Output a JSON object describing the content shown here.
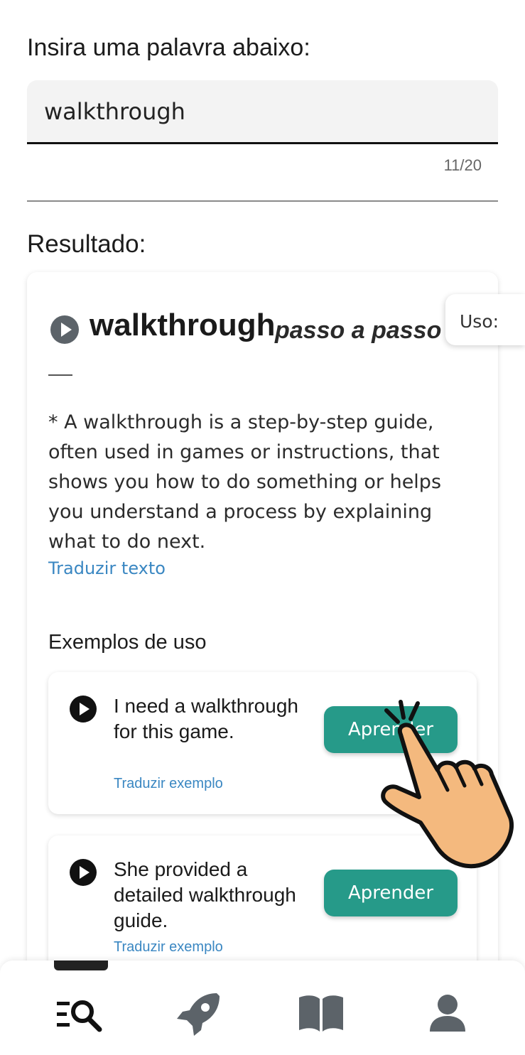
{
  "prompt": {
    "label": "Insira uma palavra abaixo:"
  },
  "search": {
    "value": "walkthrough",
    "counter": "11/20"
  },
  "result": {
    "title": "Resultado:",
    "word": "walkthrough",
    "translation": "passo a passo",
    "usage_tab": "Uso:",
    "definition": "* A walkthrough is a step-by-step guide, often used in games or instructions, that shows you how to do something or helps you understand a process by explaining what to do next.",
    "translate_text_link": "Traduzir texto",
    "examples_title": "Exemplos de uso",
    "examples": [
      {
        "text": "I need a walkthrough for this game.",
        "translate_link": "Traduzir exemplo",
        "button": "Aprender"
      },
      {
        "text": "She provided a detailed walkthrough guide.",
        "translate_link": "Traduzir exemplo",
        "button": "Aprender"
      }
    ]
  },
  "nav": {
    "items": [
      {
        "icon": "search-list-icon",
        "active": true
      },
      {
        "icon": "rocket-icon",
        "active": false
      },
      {
        "icon": "book-icon",
        "active": false
      },
      {
        "icon": "user-icon",
        "active": false
      }
    ]
  },
  "colors": {
    "accent": "#269a89",
    "link": "#3a87c2",
    "nav_icon": "#5c6369"
  }
}
